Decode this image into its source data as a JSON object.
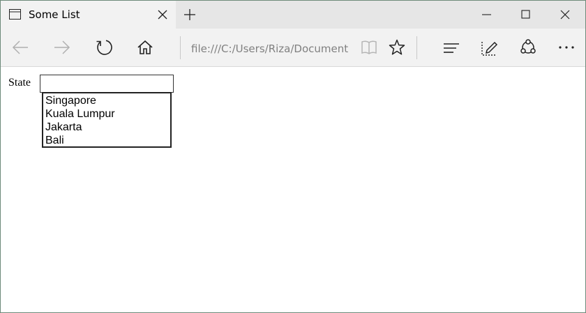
{
  "window": {
    "tab_title": "Some List"
  },
  "icons": {
    "tab": "page-icon",
    "close_tab": "close-icon",
    "new_tab": "plus-icon",
    "minimize": "minimize-icon",
    "maximize": "maximize-icon",
    "close_window": "close-icon",
    "back": "arrow-left-icon",
    "forward": "arrow-right-icon",
    "refresh": "refresh-icon",
    "home": "home-icon",
    "reading_view": "book-icon",
    "favorite": "star-icon",
    "hub": "hub-icon",
    "web_note": "pen-icon",
    "share": "share-icon",
    "more": "more-icon"
  },
  "toolbar": {
    "address": "file:///C:/Users/Riza/Document"
  },
  "form": {
    "label": "State",
    "input_value": "",
    "options": [
      "Singapore",
      "Kuala Lumpur",
      "Jakarta",
      "Bali"
    ]
  },
  "colors": {
    "tabbar_bg": "#e6e6e6",
    "toolbar_bg": "#f2f2f2",
    "window_border": "#6d8a79"
  }
}
